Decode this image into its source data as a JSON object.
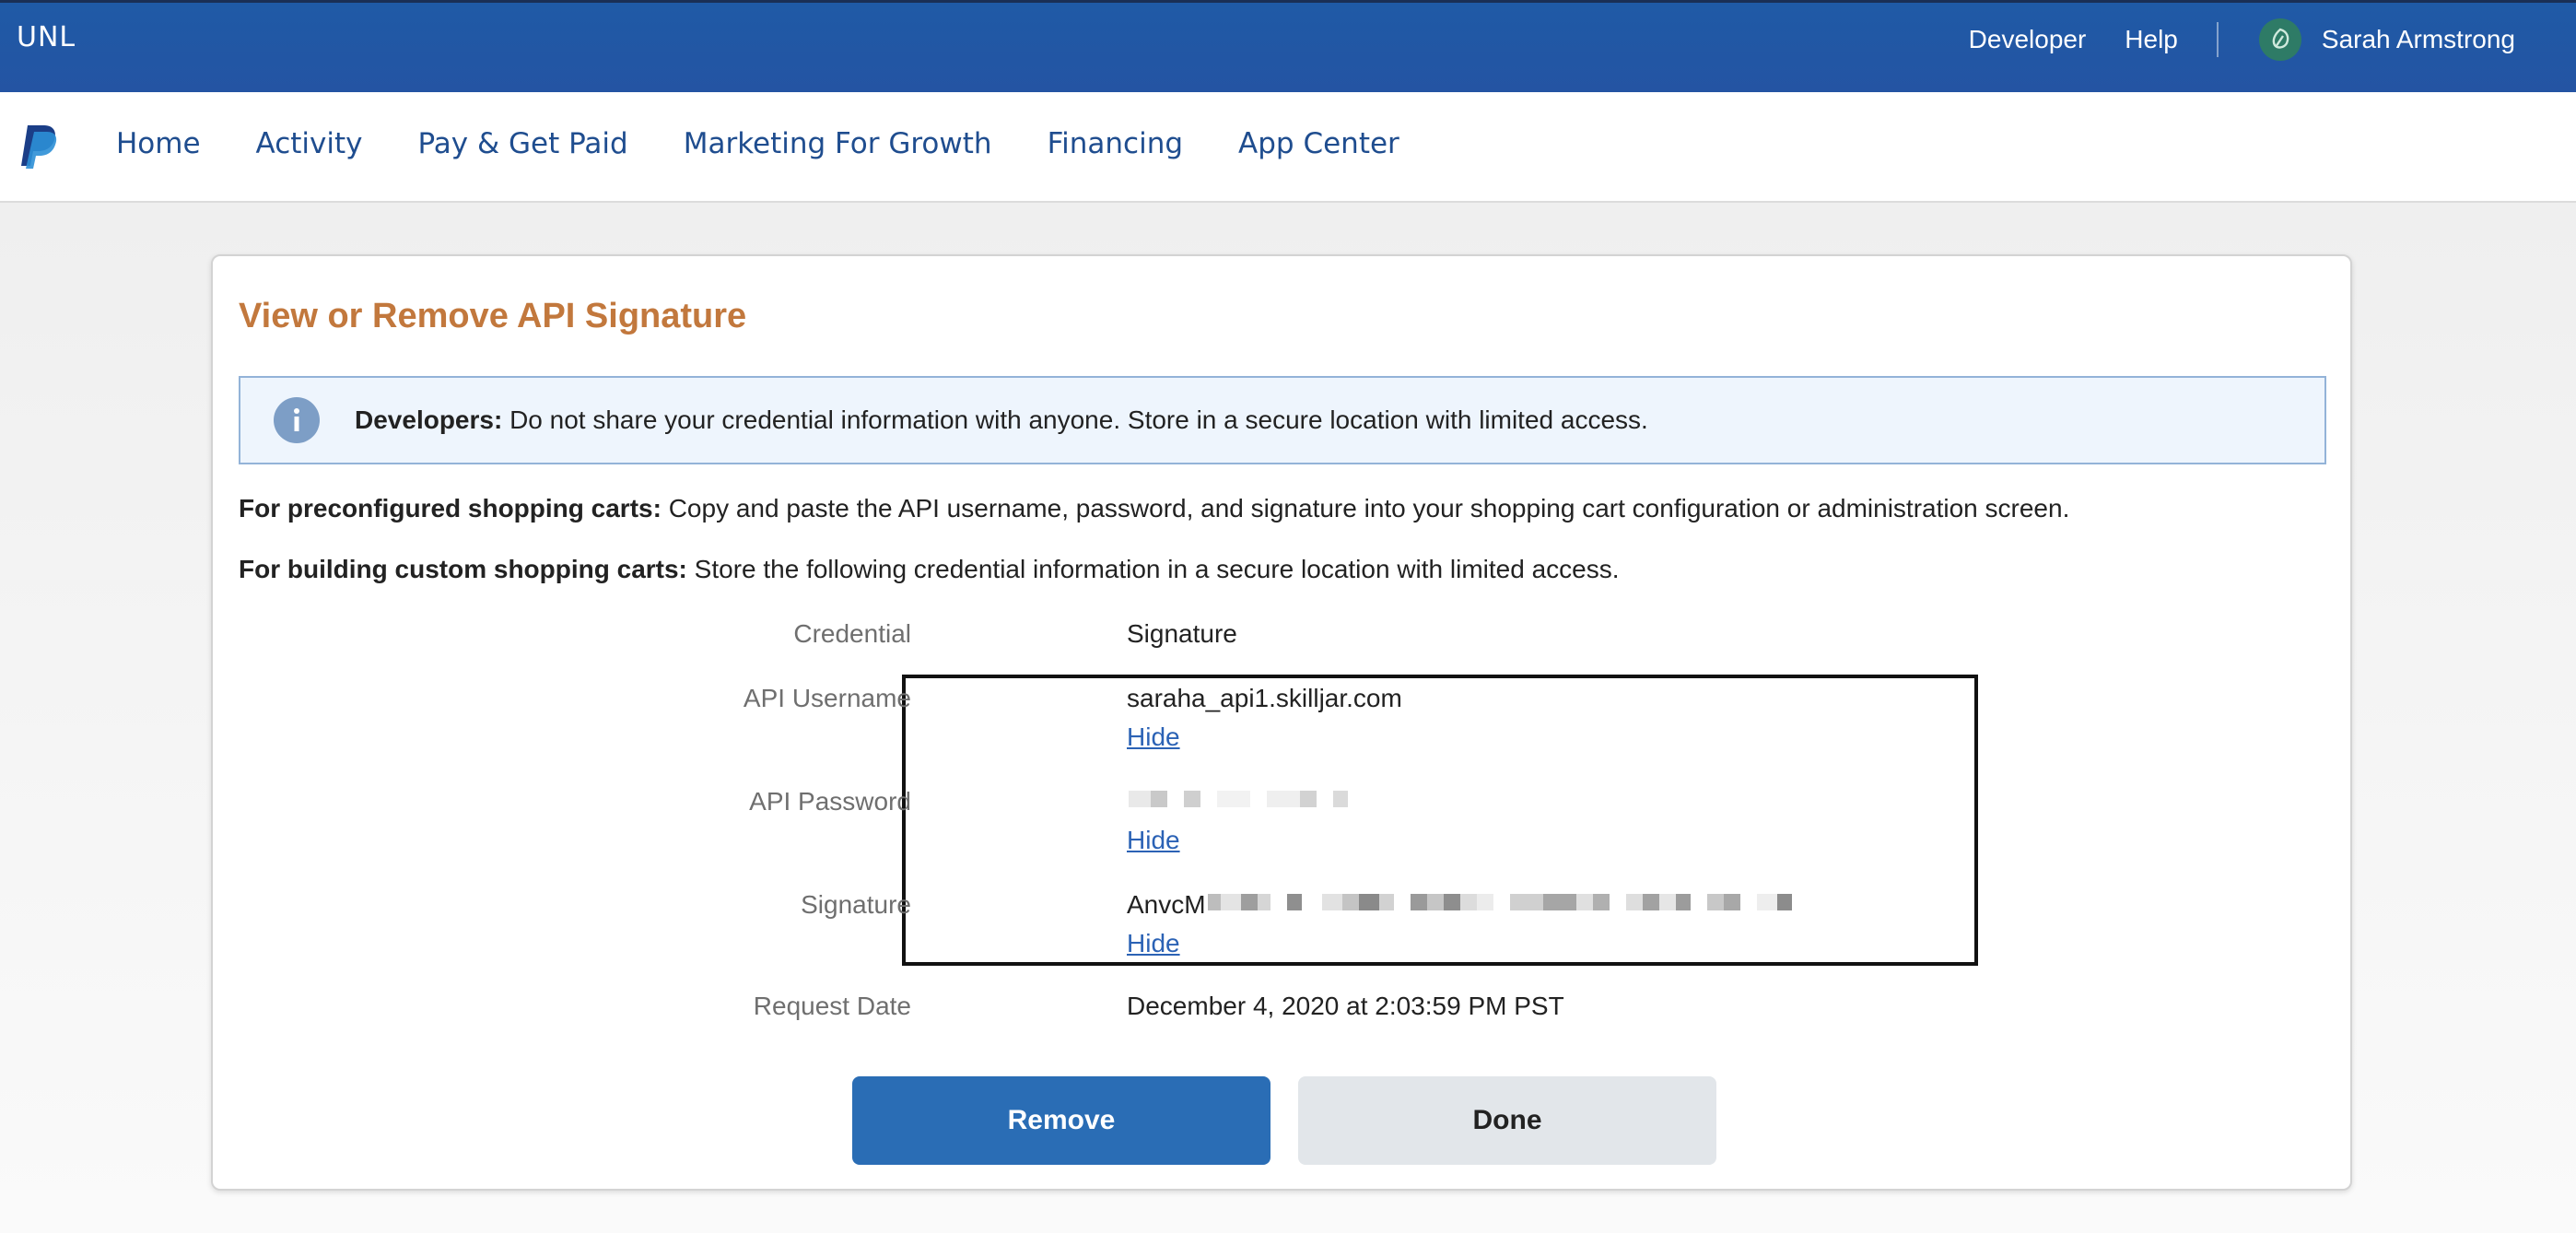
{
  "topbar": {
    "brand": "UNL",
    "links": [
      "Developer",
      "Help"
    ],
    "user_name": "Sarah Armstrong",
    "user_avatar_icon": "leaf-avatar-icon"
  },
  "nav": {
    "logo_icon": "paypal-logo-icon",
    "items": [
      "Home",
      "Activity",
      "Pay & Get Paid",
      "Marketing For Growth",
      "Financing",
      "App Center"
    ]
  },
  "card": {
    "title": "View or Remove API Signature",
    "notice": {
      "icon": "info-icon",
      "bold": "Developers:",
      "text": " Do not share your credential information with anyone. Store in a secure location with limited access."
    },
    "preconfigured": {
      "bold": "For preconfigured shopping carts:",
      "text": " Copy and paste the API username, password, and signature into your shopping cart configuration or administration screen."
    },
    "custom": {
      "bold": "For building custom shopping carts:",
      "text": " Store the following credential information in a secure location with limited access."
    },
    "fields": {
      "credential": {
        "label": "Credential",
        "value": "Signature"
      },
      "api_username": {
        "label": "API Username",
        "value": "saraha_api1.skilljar.com",
        "action": "Hide"
      },
      "api_password": {
        "label": "API Password",
        "value": "",
        "action": "Hide"
      },
      "signature": {
        "label": "Signature",
        "value": "AnvcM",
        "action": "Hide"
      },
      "request_date": {
        "label": "Request Date",
        "value": "December 4, 2020 at 2:03:59 PM PST"
      }
    },
    "buttons": {
      "remove": "Remove",
      "done": "Done"
    }
  },
  "colors": {
    "topbar": "#2454a3",
    "nav_text": "#1f4d8f",
    "title": "#c2783d",
    "link": "#2b62b5",
    "primary_button": "#2a6db5",
    "secondary_button": "#e2e6ea"
  }
}
